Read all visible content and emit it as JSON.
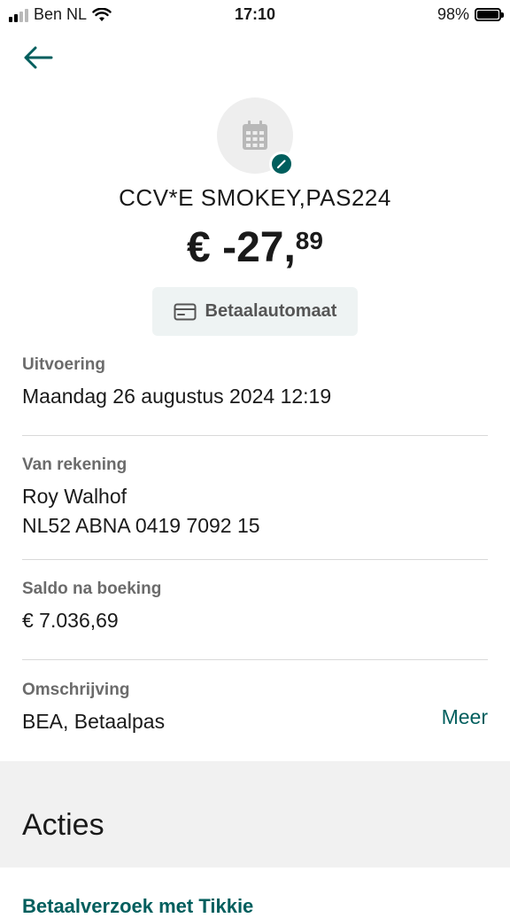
{
  "status_bar": {
    "carrier": "Ben NL",
    "time": "17:10",
    "battery": "98%",
    "battery_level": 0.98
  },
  "header": {
    "back_icon": "arrow-left-icon"
  },
  "transaction": {
    "merchant_icon": "calendar-icon",
    "edit_icon": "pencil-icon",
    "merchant": "CCV*E SMOKEY,PAS224",
    "amount_main": "€ -27,",
    "amount_cents": "89",
    "type_icon": "credit-card-icon",
    "type_label": "Betaalautomaat"
  },
  "details": {
    "execution": {
      "label": "Uitvoering",
      "value": "Maandag 26 augustus 2024 12:19"
    },
    "from_account": {
      "label": "Van rekening",
      "name": "Roy Walhof",
      "iban": "NL52 ABNA 0419 7092 15"
    },
    "balance": {
      "label": "Saldo na boeking",
      "value": "€ 7.036,69"
    },
    "description": {
      "label": "Omschrijving",
      "value": "BEA, Betaalpas",
      "more_link": "Meer"
    }
  },
  "actions": {
    "title": "Acties",
    "first_item": "Betaalverzoek met Tikkie"
  },
  "colors": {
    "accent": "#005e5d",
    "label_gray": "#6b6b6b",
    "chip_bg": "#eef3f3",
    "band_bg": "#f1f1f1"
  }
}
